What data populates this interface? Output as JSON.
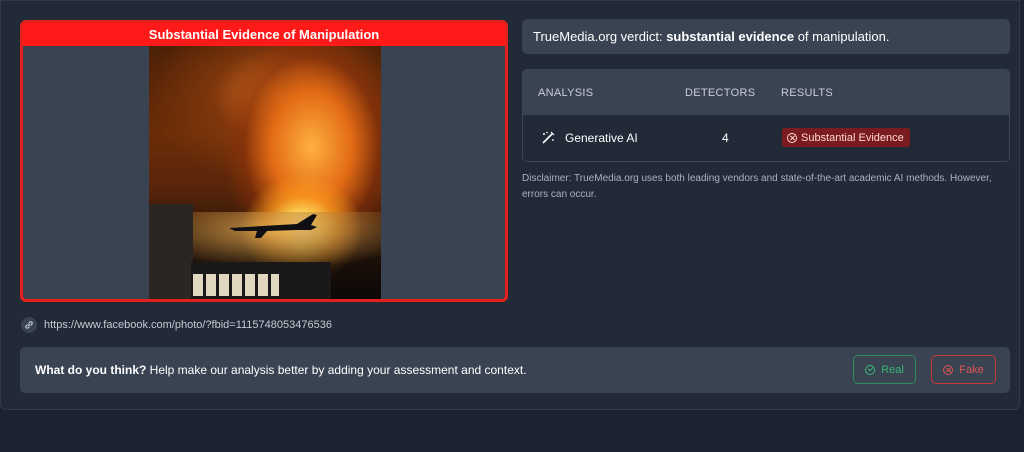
{
  "media": {
    "banner": "Substantial Evidence of Manipulation",
    "url": "https://www.facebook.com/photo/?fbid=1115748053476536"
  },
  "verdict": {
    "prefix": "TrueMedia.org verdict: ",
    "emphasis": "substantial evidence",
    "suffix": " of manipulation."
  },
  "analysis_table": {
    "headers": {
      "analysis": "ANALYSIS",
      "detectors": "DETECTORS",
      "results": "RESULTS"
    },
    "rows": [
      {
        "analysis": "Generative AI",
        "detectors": "4",
        "result": "Substantial Evidence",
        "icon": "magic-wand-icon"
      }
    ]
  },
  "disclaimer": "Disclaimer: TrueMedia.org uses both leading vendors and state-of-the-art academic AI methods. However, errors can occur.",
  "feedback": {
    "question": "What do you think?",
    "prompt": " Help make our analysis better by adding your assessment and context.",
    "real_label": "Real",
    "fake_label": "Fake"
  },
  "colors": {
    "manipulation_red": "#ff1a1a",
    "real_green": "#39b775",
    "fake_red": "#e15557",
    "panel_bg": "#3a4352"
  }
}
